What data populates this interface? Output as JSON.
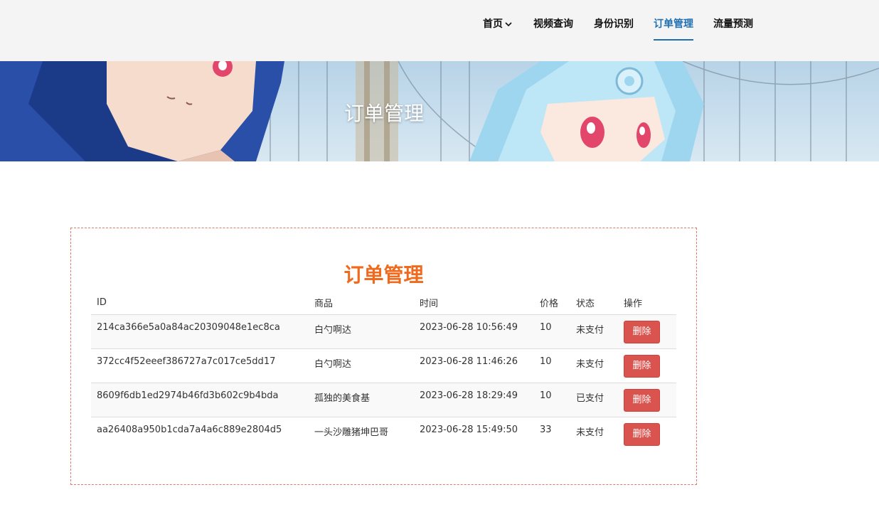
{
  "nav": {
    "items": [
      {
        "label": "首页",
        "has_dropdown": true
      },
      {
        "label": "视频查询"
      },
      {
        "label": "身份识别"
      },
      {
        "label": "订单管理",
        "active": true
      },
      {
        "label": "流量预测"
      }
    ],
    "active_color": "#1f6fb2"
  },
  "banner": {
    "title": "订单管理"
  },
  "panel": {
    "title": "订单管理",
    "title_color": "#f06a1e",
    "border_color": "#e07a6a"
  },
  "table": {
    "headers": [
      "ID",
      "商品",
      "时间",
      "价格",
      "状态",
      "操作"
    ],
    "rows": [
      {
        "id": "214ca366e5a0a84ac20309048e1ec8ca",
        "product": "白勺啊达",
        "time": "2023-06-28 10:56:49",
        "price": "10",
        "status": "未支付",
        "action": "删除"
      },
      {
        "id": "372cc4f52eeef386727a7c017ce5dd17",
        "product": "白勺啊达",
        "time": "2023-06-28 11:46:26",
        "price": "10",
        "status": "未支付",
        "action": "删除"
      },
      {
        "id": "8609f6db1ed2974b46fd3b602c9b4bda",
        "product": "孤独的美食基",
        "time": "2023-06-28 18:29:49",
        "price": "10",
        "status": "已支付",
        "action": "删除"
      },
      {
        "id": "aa26408a950b1cda7a4a6c889e2804d5",
        "product": "一头沙雕猪坤巴哥",
        "time": "2023-06-28 15:49:50",
        "price": "33",
        "status": "未支付",
        "action": "删除"
      }
    ],
    "delete_button_color": "#d9534f"
  }
}
